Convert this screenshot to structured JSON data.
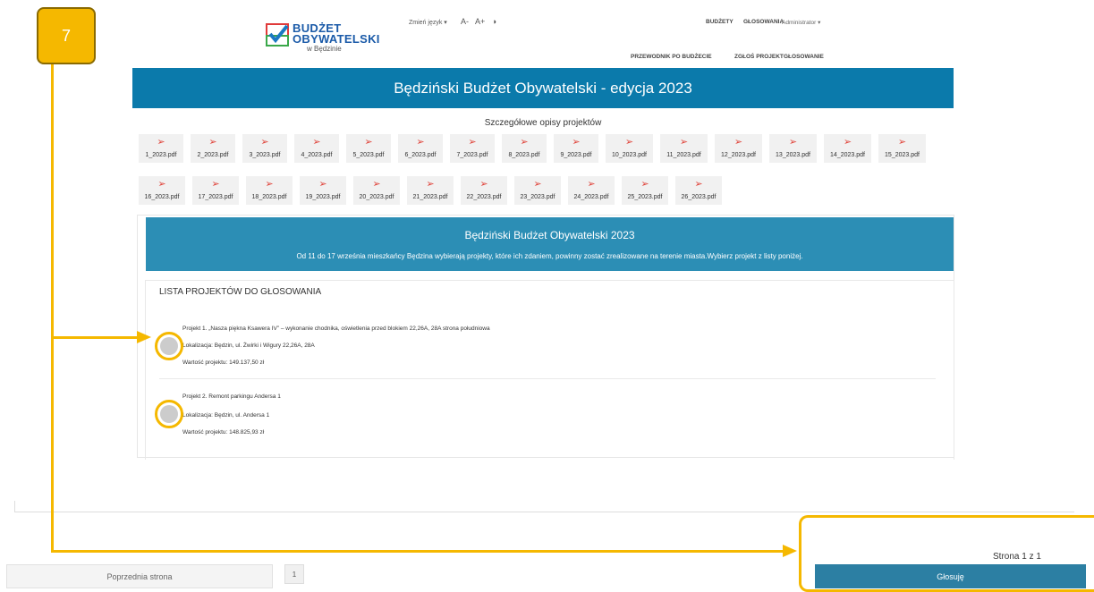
{
  "badge": "7",
  "header": {
    "logo_line1": "BUDŻET",
    "logo_line2": "OBYWATELSKI",
    "logo_line3": "w Będzinie",
    "lang_label": "Zmień język ▾",
    "font_minus": "A-",
    "font_plus": "A+",
    "contrast_icon": "◑",
    "nav": [
      "BUDŻETY",
      "GŁOSOWANIA",
      "Administrator ▾"
    ],
    "subnav": [
      "PRZEWODNIK PO BUDŻECIE",
      "ZGŁOŚ PROJEKT",
      "GŁOSOWANIE"
    ]
  },
  "banner_title": "Będziński Budżet Obywatelski - edycja 2023",
  "descriptions_title": "Szczegółowe opisy projektów",
  "pdfs_row1": [
    "1_2023.pdf",
    "2_2023.pdf",
    "3_2023.pdf",
    "4_2023.pdf",
    "5_2023.pdf",
    "6_2023.pdf",
    "7_2023.pdf",
    "8_2023.pdf",
    "9_2023.pdf",
    "10_2023.pdf",
    "11_2023.pdf",
    "12_2023.pdf",
    "13_2023.pdf",
    "14_2023.pdf",
    "15_2023.pdf"
  ],
  "pdfs_row2": [
    "16_2023.pdf",
    "17_2023.pdf",
    "18_2023.pdf",
    "19_2023.pdf",
    "20_2023.pdf",
    "21_2023.pdf",
    "22_2023.pdf",
    "23_2023.pdf",
    "24_2023.pdf",
    "25_2023.pdf",
    "26_2023.pdf"
  ],
  "card": {
    "title": "Będziński Budżet Obywatelski 2023",
    "subtitle": "Od 11 do 17 września mieszkańcy Będzina wybierają projekty, które ich zdaniem, powinny zostać zrealizowane na terenie miasta.Wybierz projekt z listy poniżej."
  },
  "list_title": "LISTA PROJEKTÓW DO GŁOSOWANIA",
  "projects": [
    {
      "name": "Projekt 1. „Nasza piękna Ksawera IV” – wykonanie chodnika, oświetlenia przed blokiem 22,26A, 28A strona południowa",
      "location": "Lokalizacja: Będzin, ul. Żwirki i Wigury 22,26A, 28A",
      "value": "Wartość projektu: 149.137,50 zł"
    },
    {
      "name": "Projekt 2. Remont parkingu Andersa 1",
      "location": "Lokalizacja: Będzin, ul. Andersa 1",
      "value": "Wartość projektu: 148.825,93 zł"
    }
  ],
  "pagination": {
    "page_info": "Strona 1 z 1",
    "prev_label": "Poprzednia strona",
    "current_page": "1",
    "vote_label": "Głosuję"
  },
  "colors": {
    "banner": "#0b7aab",
    "card_header": "#2c8eb5",
    "vote_button": "#2c7fa3",
    "highlight": "#f5b800"
  }
}
